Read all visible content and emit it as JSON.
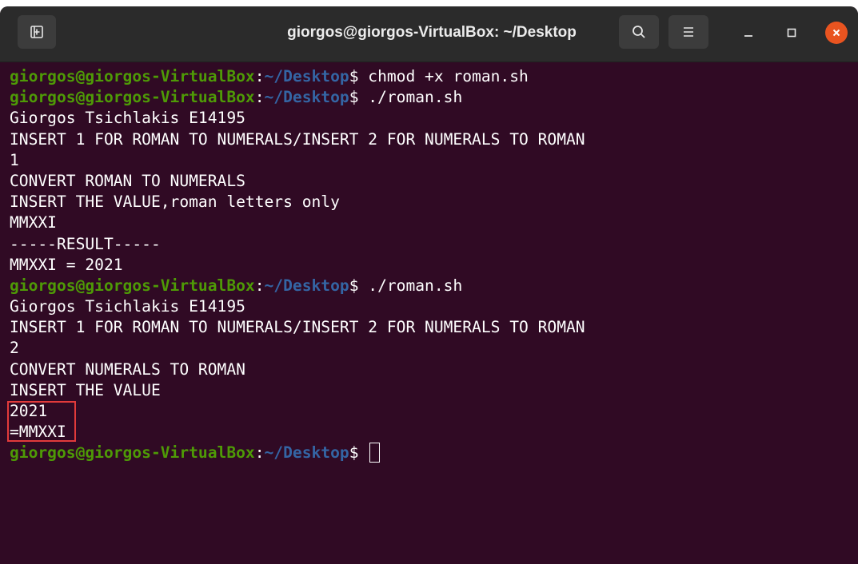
{
  "window": {
    "title": "giorgos@giorgos-VirtualBox: ~/Desktop"
  },
  "titlebar": {
    "new_tab_icon": "new-tab-icon",
    "search_icon": "search-icon",
    "menu_icon": "hamburger-menu-icon",
    "minimize_icon": "minimize-icon",
    "maximize_icon": "maximize-icon",
    "close_icon": "close-icon"
  },
  "colors": {
    "terminal_bg": "#300a24",
    "titlebar_bg": "#2b2b2b",
    "prompt_user": "#4e9a06",
    "prompt_path": "#3465a4",
    "close_button": "#e95420",
    "highlight_box": "#e23b3b"
  },
  "prompt": {
    "user_host": "giorgos@giorgos-VirtualBox",
    "colon": ":",
    "path": "~/Desktop",
    "symbol": "$"
  },
  "terminal": {
    "lines": [
      {
        "type": "prompt",
        "command": " chmod +x roman.sh"
      },
      {
        "type": "prompt",
        "command": " ./roman.sh"
      },
      {
        "type": "output",
        "text": "Giorgos Tsichlakis E14195"
      },
      {
        "type": "output",
        "text": "INSERT 1 FOR ROMAN TO NUMERALS/INSERT 2 FOR NUMERALS TO ROMAN"
      },
      {
        "type": "output",
        "text": "1"
      },
      {
        "type": "output",
        "text": "CONVERT ROMAN TO NUMERALS"
      },
      {
        "type": "output",
        "text": "INSERT THE VALUE,roman letters only"
      },
      {
        "type": "output",
        "text": "MMXXI"
      },
      {
        "type": "output",
        "text": "-----RESULT-----"
      },
      {
        "type": "output",
        "text": "MMXXI = 2021"
      },
      {
        "type": "prompt",
        "command": " ./roman.sh"
      },
      {
        "type": "output",
        "text": "Giorgos Tsichlakis E14195"
      },
      {
        "type": "output",
        "text": "INSERT 1 FOR ROMAN TO NUMERALS/INSERT 2 FOR NUMERALS TO ROMAN"
      },
      {
        "type": "output",
        "text": "2"
      },
      {
        "type": "output",
        "text": "CONVERT NUMERALS TO ROMAN"
      },
      {
        "type": "output",
        "text": "INSERT THE VALUE"
      },
      {
        "type": "output",
        "text": "2021"
      },
      {
        "type": "output",
        "text": "=MMXXI"
      },
      {
        "type": "prompt",
        "command": " ",
        "cursor": true
      }
    ]
  }
}
